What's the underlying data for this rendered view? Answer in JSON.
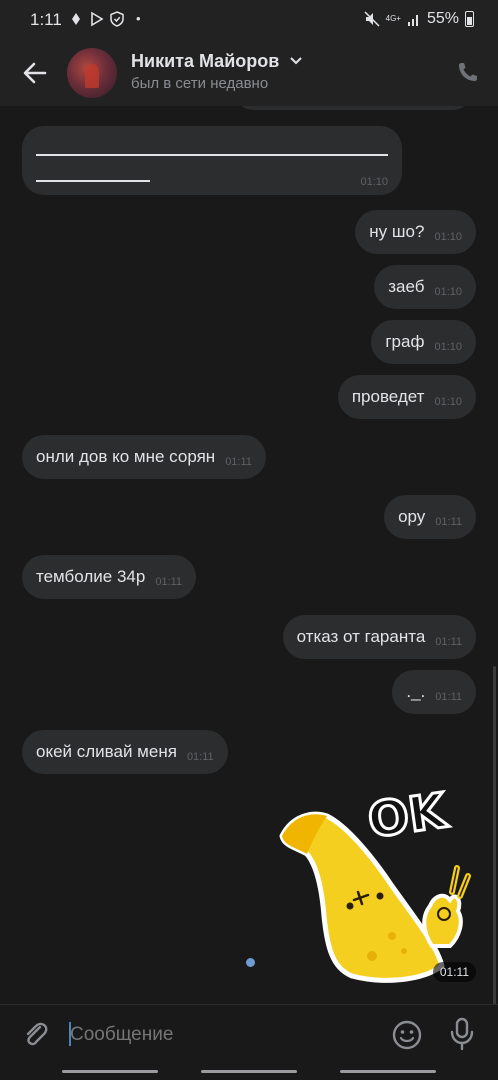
{
  "status_bar": {
    "time": "1:11",
    "network": "4G+",
    "battery": "55%"
  },
  "header": {
    "contact_name": "Никита Майоров",
    "last_seen": "был в сети недавно"
  },
  "messages": [
    {
      "dir": "out",
      "text": "ну шо?",
      "time": "01:10"
    },
    {
      "dir": "out",
      "text": "заеб",
      "time": "01:10"
    },
    {
      "dir": "out",
      "text": "граф",
      "time": "01:10"
    },
    {
      "dir": "out",
      "text": "проведет",
      "time": "01:10"
    },
    {
      "dir": "in",
      "text": "онли дов ко мне сорян",
      "time": "01:11"
    },
    {
      "dir": "out",
      "text": "ору",
      "time": "01:11"
    },
    {
      "dir": "in",
      "text": "темболие 34р",
      "time": "01:11"
    },
    {
      "dir": "out",
      "text": "отказ от гаранта",
      "time": "01:11"
    },
    {
      "dir": "out",
      "text": "._.",
      "time": "01:11"
    },
    {
      "dir": "in",
      "text": "окей сливай меня",
      "time": "01:11"
    }
  ],
  "first_message": {
    "time": "01:10"
  },
  "sticker": {
    "text": "OK",
    "time": "01:11"
  },
  "composer": {
    "placeholder": "Сообщение"
  },
  "colors": {
    "background": "#19191a",
    "bubble": "#2c2d2e",
    "accent": "#5181b8"
  }
}
